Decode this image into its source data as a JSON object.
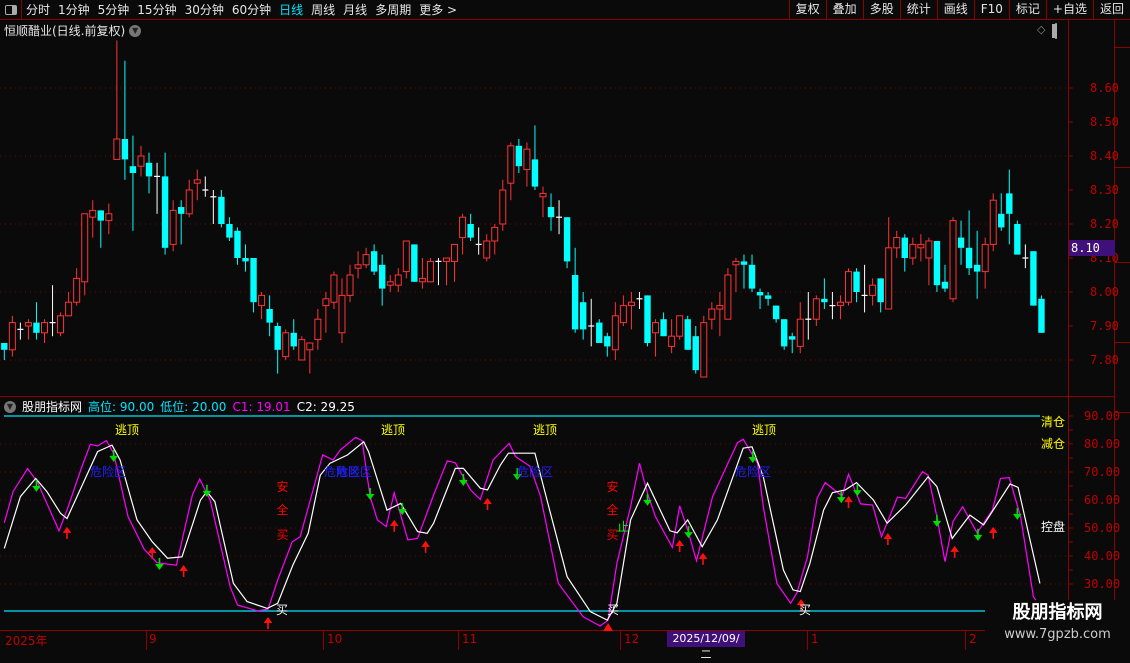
{
  "toolbar": {
    "period_tabs": [
      "分时",
      "1分钟",
      "5分钟",
      "15分钟",
      "30分钟",
      "60分钟",
      "日线",
      "周线",
      "月线",
      "多周期",
      "更多 >"
    ],
    "active_tab": "日线",
    "right_buttons": [
      "复权",
      "叠加",
      "多股",
      "统计",
      "画线",
      "F10",
      "标记",
      "+自选",
      "返回"
    ]
  },
  "main_chart": {
    "title": "恒顺醋业(日线.前复权)",
    "current_price_tag": "8.10",
    "y_axis_labels": [
      "8.60",
      "8.50",
      "8.40",
      "8.30",
      "8.20",
      "8.10",
      "8.00",
      "7.90",
      "7.80"
    ],
    "colors": {
      "up": "#ff3333",
      "down": "#00ffff",
      "flat": "#ffffff",
      "grid": "#8b0000"
    },
    "candles_ohlc": [
      [
        7.85,
        7.85,
        7.8,
        7.83
      ],
      [
        7.83,
        7.93,
        7.81,
        7.91
      ],
      [
        7.89,
        7.91,
        7.86,
        7.89
      ],
      [
        7.9,
        7.92,
        7.86,
        7.91
      ],
      [
        7.91,
        7.97,
        7.86,
        7.88
      ],
      [
        7.88,
        7.92,
        7.85,
        7.91
      ],
      [
        7.91,
        8.02,
        7.87,
        7.91
      ],
      [
        7.88,
        7.94,
        7.87,
        7.93
      ],
      [
        7.93,
        8.0,
        7.93,
        7.97
      ],
      [
        7.97,
        8.07,
        7.96,
        8.04
      ],
      [
        8.03,
        8.23,
        7.99,
        8.23
      ],
      [
        8.22,
        8.27,
        8.16,
        8.24
      ],
      [
        8.24,
        8.24,
        8.13,
        8.21
      ],
      [
        8.21,
        8.26,
        8.17,
        8.23
      ],
      [
        8.39,
        8.74,
        8.39,
        8.45
      ],
      [
        8.45,
        8.68,
        8.33,
        8.39
      ],
      [
        8.37,
        8.46,
        8.18,
        8.35
      ],
      [
        8.37,
        8.43,
        8.34,
        8.4
      ],
      [
        8.38,
        8.41,
        8.29,
        8.34
      ],
      [
        8.34,
        8.38,
        8.23,
        8.34
      ],
      [
        8.34,
        8.41,
        8.11,
        8.13
      ],
      [
        8.14,
        8.27,
        8.12,
        8.24
      ],
      [
        8.25,
        8.27,
        8.14,
        8.23
      ],
      [
        8.23,
        8.33,
        8.22,
        8.3
      ],
      [
        8.32,
        8.36,
        8.27,
        8.33
      ],
      [
        8.3,
        8.34,
        8.28,
        8.3
      ],
      [
        8.28,
        8.3,
        8.2,
        8.28
      ],
      [
        8.28,
        8.3,
        8.19,
        8.2
      ],
      [
        8.2,
        8.22,
        8.15,
        8.16
      ],
      [
        8.18,
        8.19,
        8.08,
        8.1
      ],
      [
        8.1,
        8.14,
        8.06,
        8.09
      ],
      [
        8.1,
        8.1,
        7.94,
        7.97
      ],
      [
        7.96,
        8.0,
        7.92,
        7.99
      ],
      [
        7.95,
        7.99,
        7.87,
        7.91
      ],
      [
        7.9,
        7.91,
        7.76,
        7.83
      ],
      [
        7.81,
        7.89,
        7.8,
        7.88
      ],
      [
        7.88,
        7.92,
        7.83,
        7.84
      ],
      [
        7.8,
        7.87,
        7.8,
        7.86
      ],
      [
        7.83,
        7.85,
        7.76,
        7.85
      ],
      [
        7.86,
        7.95,
        7.83,
        7.92
      ],
      [
        7.96,
        8.0,
        7.88,
        7.98
      ],
      [
        7.97,
        8.06,
        7.95,
        8.05
      ],
      [
        7.88,
        8.04,
        7.85,
        7.99
      ],
      [
        7.99,
        8.08,
        7.97,
        8.05
      ],
      [
        8.07,
        8.12,
        8.04,
        8.08
      ],
      [
        8.08,
        8.13,
        8.07,
        8.11
      ],
      [
        8.12,
        8.14,
        8.05,
        8.06
      ],
      [
        8.08,
        8.11,
        7.96,
        8.01
      ],
      [
        8.02,
        8.05,
        8.0,
        8.03
      ],
      [
        8.02,
        8.07,
        8.0,
        8.05
      ],
      [
        8.06,
        8.15,
        8.04,
        8.15
      ],
      [
        8.14,
        8.14,
        8.03,
        8.03
      ],
      [
        8.03,
        8.1,
        8.01,
        8.04
      ],
      [
        8.03,
        8.1,
        8.03,
        8.09
      ],
      [
        8.09,
        8.1,
        8.02,
        8.09
      ],
      [
        8.09,
        8.1,
        8.02,
        8.1
      ],
      [
        8.09,
        8.14,
        8.03,
        8.14
      ],
      [
        8.16,
        8.23,
        8.11,
        8.22
      ],
      [
        8.2,
        8.23,
        8.15,
        8.16
      ],
      [
        8.14,
        8.19,
        8.11,
        8.14
      ],
      [
        8.1,
        8.17,
        8.09,
        8.15
      ],
      [
        8.15,
        8.2,
        8.11,
        8.19
      ],
      [
        8.2,
        8.33,
        8.18,
        8.3
      ],
      [
        8.32,
        8.44,
        8.27,
        8.43
      ],
      [
        8.43,
        8.45,
        8.35,
        8.37
      ],
      [
        8.36,
        8.44,
        8.31,
        8.42
      ],
      [
        8.39,
        8.49,
        8.3,
        8.31
      ],
      [
        8.28,
        8.31,
        8.22,
        8.29
      ],
      [
        8.25,
        8.29,
        8.18,
        8.22
      ],
      [
        8.22,
        8.27,
        8.17,
        8.22
      ],
      [
        8.22,
        8.22,
        8.07,
        8.09
      ],
      [
        8.05,
        8.13,
        7.88,
        7.89
      ],
      [
        7.97,
        8.0,
        7.86,
        7.89
      ],
      [
        7.9,
        7.98,
        7.84,
        7.9
      ],
      [
        7.91,
        7.92,
        7.85,
        7.85
      ],
      [
        7.87,
        7.88,
        7.81,
        7.84
      ],
      [
        7.83,
        7.97,
        7.8,
        7.93
      ],
      [
        7.91,
        7.99,
        7.9,
        7.96
      ],
      [
        7.96,
        8.0,
        7.89,
        7.97
      ],
      [
        7.98,
        8.0,
        7.95,
        7.98
      ],
      [
        7.99,
        7.99,
        7.84,
        7.85
      ],
      [
        7.88,
        7.92,
        7.81,
        7.91
      ],
      [
        7.92,
        7.94,
        7.87,
        7.87
      ],
      [
        7.84,
        7.92,
        7.82,
        7.87
      ],
      [
        7.87,
        7.93,
        7.86,
        7.93
      ],
      [
        7.92,
        7.93,
        7.83,
        7.83
      ],
      [
        7.87,
        7.9,
        7.76,
        7.77
      ],
      [
        7.75,
        7.93,
        7.75,
        7.91
      ],
      [
        7.92,
        7.97,
        7.89,
        7.95
      ],
      [
        7.95,
        8.0,
        7.87,
        7.96
      ],
      [
        7.92,
        8.07,
        7.92,
        8.05
      ],
      [
        8.08,
        8.1,
        8.0,
        8.09
      ],
      [
        8.09,
        8.11,
        8.01,
        8.08
      ],
      [
        8.08,
        8.11,
        8.0,
        8.01
      ],
      [
        8.0,
        8.01,
        7.95,
        7.99
      ],
      [
        7.99,
        8.0,
        7.96,
        7.98
      ],
      [
        7.96,
        7.96,
        7.91,
        7.92
      ],
      [
        7.92,
        7.92,
        7.83,
        7.84
      ],
      [
        7.87,
        7.88,
        7.82,
        7.86
      ],
      [
        7.84,
        7.97,
        7.82,
        7.92
      ],
      [
        7.92,
        8.0,
        7.86,
        7.92
      ],
      [
        7.92,
        7.99,
        7.9,
        7.98
      ],
      [
        7.98,
        8.04,
        7.95,
        7.97
      ],
      [
        7.96,
        8.0,
        7.92,
        7.96
      ],
      [
        7.96,
        7.99,
        7.92,
        7.97
      ],
      [
        7.97,
        8.07,
        7.96,
        8.06
      ],
      [
        8.06,
        8.07,
        7.97,
        8.0
      ],
      [
        7.99,
        8.08,
        7.94,
        7.99
      ],
      [
        7.99,
        8.04,
        7.96,
        8.02
      ],
      [
        8.04,
        8.04,
        7.94,
        7.97
      ],
      [
        7.95,
        8.22,
        7.95,
        8.13
      ],
      [
        8.13,
        8.18,
        8.1,
        8.16
      ],
      [
        8.16,
        8.17,
        8.06,
        8.1
      ],
      [
        8.1,
        8.16,
        8.08,
        8.14
      ],
      [
        8.13,
        8.17,
        8.09,
        8.14
      ],
      [
        8.1,
        8.16,
        8.02,
        8.15
      ],
      [
        8.15,
        8.15,
        8.0,
        8.02
      ],
      [
        8.03,
        8.08,
        8.0,
        8.01
      ],
      [
        7.98,
        8.22,
        7.97,
        8.21
      ],
      [
        8.16,
        8.21,
        8.08,
        8.13
      ],
      [
        8.13,
        8.24,
        8.05,
        8.07
      ],
      [
        8.08,
        8.18,
        7.98,
        8.06
      ],
      [
        8.06,
        8.16,
        8.01,
        8.14
      ],
      [
        8.14,
        8.29,
        8.12,
        8.27
      ],
      [
        8.23,
        8.29,
        8.18,
        8.19
      ],
      [
        8.29,
        8.36,
        8.14,
        8.23
      ],
      [
        8.2,
        8.21,
        8.11,
        8.11
      ],
      [
        8.1,
        8.14,
        8.07,
        8.1
      ],
      [
        8.12,
        8.12,
        7.96,
        7.96
      ],
      [
        7.98,
        7.99,
        7.88,
        7.88
      ]
    ]
  },
  "indicator": {
    "name": "股朋指标网",
    "high_level": {
      "label": "高位: 90.00",
      "value": 90
    },
    "low_level": {
      "label": "低位: 20.00",
      "value": 20
    },
    "c1": {
      "label": "C1: 19.01",
      "color": "#ff00ff"
    },
    "c2": {
      "label": "C2: 29.25",
      "color": "#ffffff"
    },
    "y_axis_labels": [
      "90.00",
      "80.00",
      "70.00",
      "60.00",
      "50.00",
      "40.00",
      "30.00"
    ],
    "right_labels": {
      "clear": "清仓",
      "reduce": "减仓",
      "control": "控盘"
    },
    "escape_top_label": "逃顶",
    "danger_label": "危险区",
    "safe_buy_chars": [
      "安",
      "全",
      "买"
    ],
    "stop_label": "止",
    "buy_label": "买",
    "c1_line": [
      [
        0,
        51.9
      ],
      [
        1.1,
        63
      ],
      [
        2.9,
        71.2
      ],
      [
        4.1,
        66.5
      ],
      [
        6.8,
        49
      ],
      [
        7.8,
        56.4
      ],
      [
        9.5,
        70.7
      ],
      [
        10.7,
        79.9
      ],
      [
        11.6,
        79.3
      ],
      [
        12.7,
        81.2
      ],
      [
        13.6,
        76.7
      ],
      [
        15.4,
        54
      ],
      [
        17.4,
        42.4
      ],
      [
        19,
        37.6
      ],
      [
        21.4,
        36.7
      ],
      [
        23.4,
        61.8
      ],
      [
        24.3,
        67.5
      ],
      [
        25.6,
        60
      ],
      [
        28.1,
        29
      ],
      [
        29,
        22.5
      ],
      [
        31.5,
        20.4
      ],
      [
        32.8,
        21
      ],
      [
        34,
        31.4
      ],
      [
        35.8,
        45
      ],
      [
        36.8,
        46.9
      ],
      [
        39.6,
        76.1
      ],
      [
        40.9,
        74.3
      ],
      [
        41.8,
        77.9
      ],
      [
        43.7,
        82.4
      ],
      [
        44.5,
        81.2
      ],
      [
        45.5,
        61.2
      ],
      [
        46.4,
        52.9
      ],
      [
        47.5,
        50.5
      ],
      [
        48.5,
        62.6
      ],
      [
        50.2,
        45.7
      ],
      [
        51.4,
        46.3
      ],
      [
        53.4,
        61.8
      ],
      [
        55.1,
        74
      ],
      [
        56.1,
        73.3
      ],
      [
        58,
        63.6
      ],
      [
        59.2,
        60.2
      ],
      [
        60.8,
        74.3
      ],
      [
        62.8,
        80.2
      ],
      [
        63.6,
        75.5
      ],
      [
        65.4,
        72
      ],
      [
        66.7,
        61.2
      ],
      [
        68.9,
        30.2
      ],
      [
        72,
        18.3
      ],
      [
        74.1,
        15
      ],
      [
        75.1,
        17.1
      ],
      [
        76.2,
        37.4
      ],
      [
        77.9,
        57.6
      ],
      [
        79,
        73.1
      ],
      [
        80,
        62.4
      ],
      [
        81,
        54
      ],
      [
        83.1,
        43.1
      ],
      [
        84,
        57.9
      ],
      [
        85,
        49.3
      ],
      [
        86.1,
        38.3
      ],
      [
        88.1,
        61.2
      ],
      [
        91.2,
        80.5
      ],
      [
        91.9,
        81.7
      ],
      [
        93.7,
        73.1
      ],
      [
        94.4,
        57.6
      ],
      [
        96.1,
        30.2
      ],
      [
        97.8,
        23.1
      ],
      [
        98.6,
        26.9
      ],
      [
        99.9,
        39.7
      ],
      [
        101.1,
        60.6
      ],
      [
        102.1,
        66.2
      ],
      [
        104.2,
        61.4
      ],
      [
        105,
        69.2
      ],
      [
        106.5,
        58.6
      ],
      [
        108,
        58.2
      ],
      [
        109.1,
        46.9
      ],
      [
        111.1,
        61
      ],
      [
        112.1,
        60.6
      ],
      [
        114.2,
        70.1
      ],
      [
        114.9,
        68.9
      ],
      [
        116,
        54
      ],
      [
        117,
        38
      ],
      [
        118,
        52.3
      ],
      [
        119.2,
        57.6
      ],
      [
        121,
        48.3
      ],
      [
        122.9,
        56.4
      ],
      [
        123.9,
        67.7
      ],
      [
        125,
        68
      ],
      [
        126.4,
        54
      ],
      [
        128,
        25.5
      ],
      [
        128.8,
        22
      ]
    ],
    "c2_line": [
      [
        0,
        42.7
      ],
      [
        2,
        61.2
      ],
      [
        3.9,
        67.7
      ],
      [
        5.3,
        63
      ],
      [
        7,
        55.2
      ],
      [
        7.8,
        53.4
      ],
      [
        9.8,
        66
      ],
      [
        11.6,
        77.3
      ],
      [
        13.4,
        79.6
      ],
      [
        14.4,
        74.3
      ],
      [
        16.5,
        52.9
      ],
      [
        18.4,
        45.1
      ],
      [
        20.3,
        39.2
      ],
      [
        22.1,
        39.7
      ],
      [
        24.4,
        60
      ],
      [
        25.2,
        63
      ],
      [
        26.2,
        59.4
      ],
      [
        28.5,
        30.2
      ],
      [
        30.2,
        23.7
      ],
      [
        32.7,
        21.3
      ],
      [
        34,
        23.1
      ],
      [
        35.9,
        36.8
      ],
      [
        37.8,
        48.1
      ],
      [
        39.3,
        68.9
      ],
      [
        40.5,
        73.1
      ],
      [
        42.7,
        76.1
      ],
      [
        44.7,
        80.8
      ],
      [
        45.3,
        77.3
      ],
      [
        47.6,
        56.4
      ],
      [
        49.3,
        58.8
      ],
      [
        51.4,
        48.7
      ],
      [
        52.6,
        48.1
      ],
      [
        53.4,
        51.7
      ],
      [
        56.1,
        71.3
      ],
      [
        57.1,
        71.3
      ],
      [
        59.2,
        64.2
      ],
      [
        60.1,
        63.6
      ],
      [
        61.7,
        72.5
      ],
      [
        62.7,
        76.7
      ],
      [
        66,
        76.7
      ],
      [
        67.5,
        60
      ],
      [
        70,
        32.6
      ],
      [
        72.9,
        20.1
      ],
      [
        75,
        17.1
      ],
      [
        76.2,
        23.1
      ],
      [
        77.9,
        52.9
      ],
      [
        80,
        66
      ],
      [
        82.8,
        49
      ],
      [
        83.7,
        48.3
      ],
      [
        85,
        52.9
      ],
      [
        86.8,
        43.3
      ],
      [
        88.7,
        52.9
      ],
      [
        91.9,
        78.5
      ],
      [
        93,
        79
      ],
      [
        94.4,
        68.3
      ],
      [
        96.9,
        35
      ],
      [
        98.1,
        27.9
      ],
      [
        99,
        27.3
      ],
      [
        100.2,
        37.4
      ],
      [
        101.9,
        56.4
      ],
      [
        103,
        62.6
      ],
      [
        104.6,
        63.6
      ],
      [
        106,
        66.2
      ],
      [
        108.1,
        60
      ],
      [
        109.8,
        51.7
      ],
      [
        112.1,
        58.2
      ],
      [
        114.9,
        68.3
      ],
      [
        116,
        64.8
      ],
      [
        117.9,
        46.3
      ],
      [
        120.1,
        54.6
      ],
      [
        121.8,
        51.1
      ],
      [
        125.1,
        65.7
      ],
      [
        126.1,
        64.5
      ],
      [
        128.8,
        30.2
      ]
    ],
    "sell_signals": [
      [
        4,
        62.9
      ],
      [
        13.6,
        73.6
      ],
      [
        19.3,
        35
      ],
      [
        25.2,
        61.1
      ],
      [
        45.5,
        60
      ],
      [
        49.5,
        54.6
      ],
      [
        57.1,
        65
      ],
      [
        63.8,
        67.1
      ],
      [
        80,
        57.9
      ],
      [
        85.1,
        46.4
      ],
      [
        93.1,
        73.2
      ],
      [
        104.1,
        58.9
      ],
      [
        106.1,
        61.4
      ],
      [
        116,
        50.4
      ],
      [
        121.1,
        45.4
      ],
      [
        126,
        52.9
      ]
    ],
    "buy_signals": [
      [
        7.8,
        50.4
      ],
      [
        18.4,
        43.2
      ],
      [
        22.3,
        36.8
      ],
      [
        32.8,
        18.2
      ],
      [
        48.5,
        52.9
      ],
      [
        52.4,
        45.4
      ],
      [
        60.1,
        60.7
      ],
      [
        84,
        45.7
      ],
      [
        86.9,
        41.1
      ],
      [
        99.1,
        24.6
      ],
      [
        105,
        61.4
      ],
      [
        109.9,
        48.2
      ],
      [
        118.2,
        43.6
      ],
      [
        123,
        50.4
      ]
    ],
    "buy_triangle": [
      75.1,
      14.6
    ]
  },
  "time_axis": {
    "labels": [
      "2025年",
      "9",
      "10",
      "11",
      "12",
      "1",
      "2"
    ],
    "cursor_date": "2025/12/09/二"
  },
  "watermark": {
    "name": "股朋指标网",
    "url": "www.7gpzb.com"
  }
}
